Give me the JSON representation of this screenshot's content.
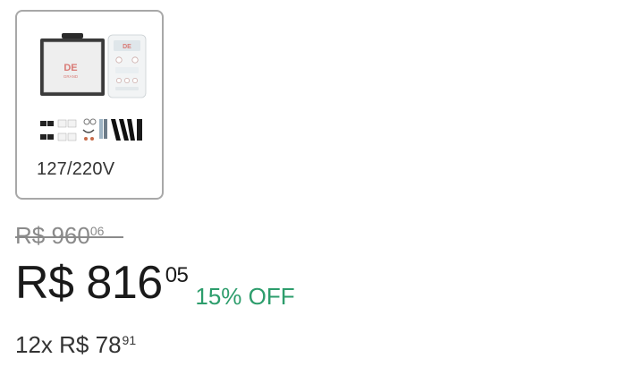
{
  "variant": {
    "label": "127/220V",
    "image_brand_text": "DE GRAND"
  },
  "pricing": {
    "original_price_main": "R$ 960",
    "original_price_cents": "06",
    "current_price_main": "R$ 816",
    "current_price_cents": "05",
    "discount_label": "15% OFF",
    "installments_main": "12x R$ 78",
    "installments_cents": "91"
  },
  "colors": {
    "discount_green": "#2d9d6c",
    "card_border": "#a8a8a8",
    "old_price_gray": "#8a8a8a"
  }
}
